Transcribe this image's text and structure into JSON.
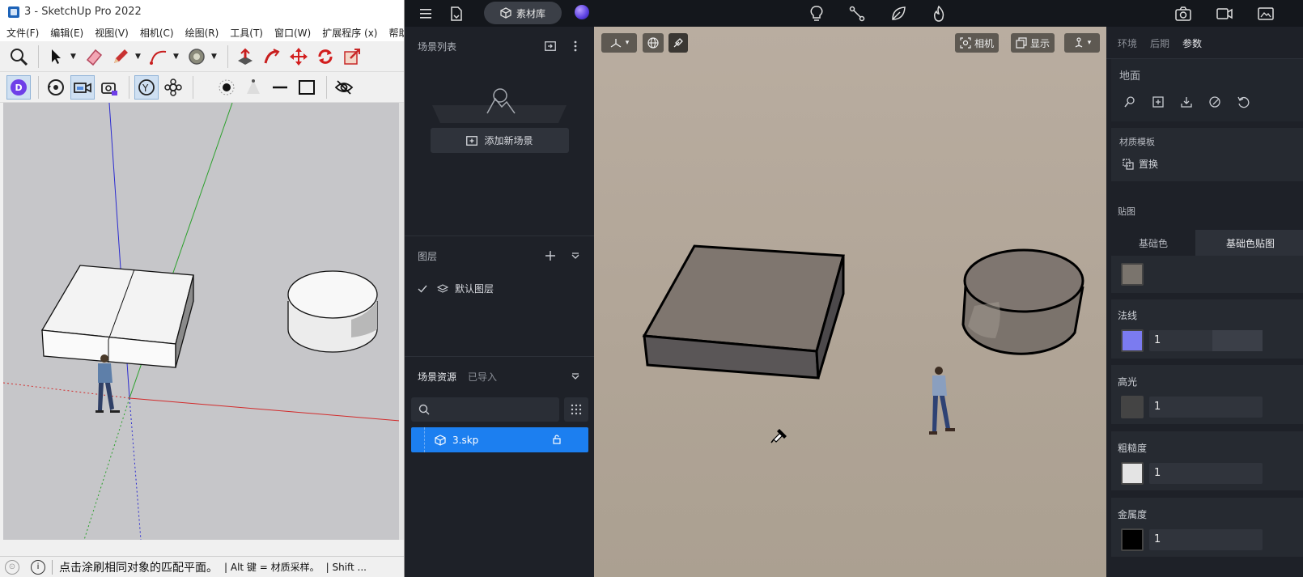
{
  "sketchup": {
    "title": "3 - SketchUp Pro 2022",
    "menu": [
      "文件(F)",
      "编辑(E)",
      "视图(V)",
      "相机(C)",
      "绘图(R)",
      "工具(T)",
      "窗口(W)",
      "扩展程序 (x)",
      "帮助(H)"
    ],
    "status": {
      "hint": "点击涂刷相同对象的匹配平面。",
      "alt": "| Alt 键 = 材质采样。",
      "shift": "| Shift ..."
    }
  },
  "d5": {
    "top": {
      "library_label": "素材库"
    },
    "left_panel": {
      "scene_list_title": "场景列表",
      "add_scene_label": "添加新场景",
      "layers_title": "图层",
      "default_layer": "默认图层",
      "resources_tab": "场景资源",
      "imported_tab": "已导入",
      "search_placeholder": "",
      "file_name": "3.skp"
    },
    "viewport": {
      "camera_label": "相机",
      "display_label": "显示"
    },
    "right_panel": {
      "tabs": [
        "环境",
        "后期",
        "参数"
      ],
      "active_tab": "参数",
      "object_title": "地面",
      "template_title": "材质模板",
      "replace_label": "置换",
      "texture_title": "贴图",
      "map_tabs": [
        "基础色",
        "基础色贴图"
      ],
      "normal_label": "法线",
      "normal_value": "1",
      "specular_label": "高光",
      "specular_value": "1",
      "roughness_label": "粗糙度",
      "roughness_value": "1",
      "metal_label": "金属度",
      "metal_value": "1",
      "colors": {
        "base": "#7a746d",
        "normal": "#7b7bf0",
        "specular": "#444444",
        "roughness": "#e4e4e4",
        "metal": "#000000"
      }
    }
  }
}
